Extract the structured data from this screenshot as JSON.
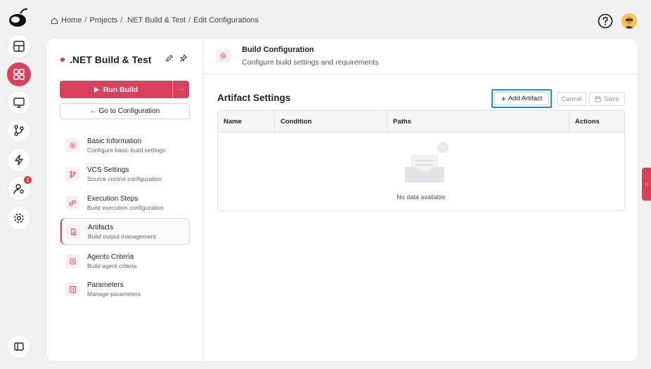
{
  "breadcrumb": {
    "home": "Home",
    "projects": "Projects",
    "project": ".NET Build & Test",
    "current": "Edit Configurations",
    "separator": "/"
  },
  "rail": {
    "notification_count": "2"
  },
  "project": {
    "title": ".NET Build & Test",
    "run_label": "Run Build",
    "more_label": "···",
    "goto_label": "← Go to Configuration"
  },
  "nav": [
    {
      "label": "Basic Information",
      "sub": "Configure basic build settings",
      "icon": "gear-icon"
    },
    {
      "label": "VCS Settings",
      "sub": "Source control configuration",
      "icon": "branch-icon"
    },
    {
      "label": "Execution Steps",
      "sub": "Build execution configuration",
      "icon": "steps-icon"
    },
    {
      "label": "Artifacts",
      "sub": "Build output management",
      "icon": "file-icon"
    },
    {
      "label": "Agents Criteria",
      "sub": "Build agent criteria",
      "icon": "agent-icon"
    },
    {
      "label": "Parameters",
      "sub": "Manage parameters",
      "icon": "sliders-icon"
    }
  ],
  "section": {
    "title": "Build Configuration",
    "subtitle": "Configure build settings and requirements"
  },
  "artifacts": {
    "title": "Artifact Settings",
    "add_label": "Add Artifact",
    "cancel_label": "Cancel",
    "save_label": "Save",
    "columns": [
      "Name",
      "Condition",
      "Paths",
      "Actions"
    ],
    "empty_text": "No data available"
  },
  "side_tab_label": "‹",
  "colors": {
    "accent": "#d9405b",
    "focus": "#1e8fe6"
  }
}
